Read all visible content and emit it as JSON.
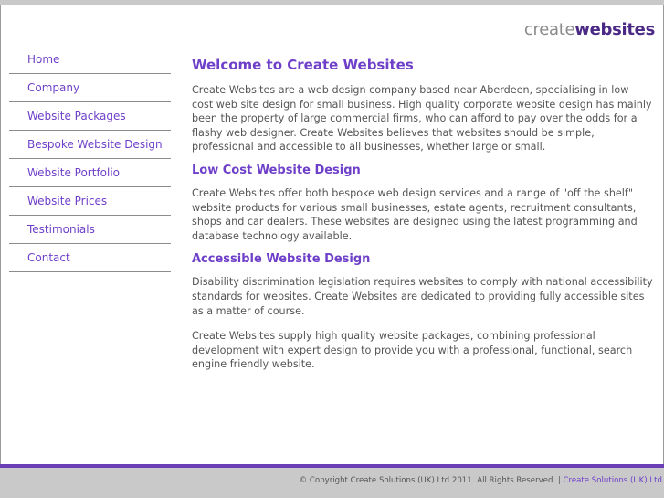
{
  "logo": {
    "part1": "create",
    "part2": "websites"
  },
  "nav": {
    "items": [
      {
        "label": "Home"
      },
      {
        "label": "Company"
      },
      {
        "label": "Website Packages"
      },
      {
        "label": "Bespoke Website Design"
      },
      {
        "label": "Website Portfolio"
      },
      {
        "label": "Website Prices"
      },
      {
        "label": "Testimonials"
      },
      {
        "label": "Contact"
      }
    ]
  },
  "main": {
    "title": "Welcome to Create Websites",
    "intro": "Create Websites are a web design company based near Aberdeen, specialising in low cost web site design for small business. High quality corporate website design has mainly been the property of large commercial firms, who can afford to pay over the odds for a flashy web designer. Create Websites believes that websites should be simple, professional and accessible to all businesses, whether large or small.",
    "section1_title": "Low Cost Website Design",
    "section1_text": "Create Websites offer both bespoke web design services and a range of \"off the shelf\" website products for various small businesses, estate agents, recruitment consultants, shops and car dealers. These websites are designed using the latest programming and database technology available.",
    "section2_title": "Accessible Website Design",
    "section2_text": "Disability discrimination legislation requires websites to comply with national accessibility standards for websites. Create Websites are dedicated to providing fully accessible sites as a matter of course.",
    "section2_text2": "Create Websites supply high quality website packages, combining professional development with expert design to provide you with a professional, functional, search engine friendly website."
  },
  "footer": {
    "copyright": "© Copyright Create Solutions (UK) Ltd 2011. All Rights Reserved. | ",
    "link": "Create Solutions (UK) Ltd"
  }
}
